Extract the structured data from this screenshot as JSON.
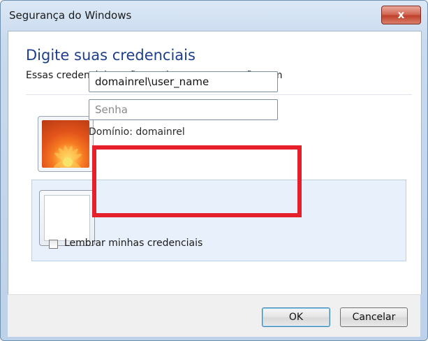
{
  "window": {
    "title": "Segurança do Windows",
    "close_glyph": "x"
  },
  "header": {
    "heading": "Digite suas credenciais",
    "subtext": "Essas credenciais serão usadas para a conexão com"
  },
  "tiles": {
    "first_icon": "flower-account-icon",
    "second_icon": "blank-account-icon"
  },
  "credentials": {
    "username_value": "domainrel\\user_name",
    "password_placeholder": "Senha",
    "domain_text": "Domínio: domainrel"
  },
  "remember": {
    "label": "Lembrar minhas credenciais",
    "checked": false
  },
  "buttons": {
    "ok": "OK",
    "cancel": "Cancelar"
  },
  "colors": {
    "heading": "#1e3e8c",
    "highlight": "#e5202a",
    "close_button": "#c0412b"
  }
}
